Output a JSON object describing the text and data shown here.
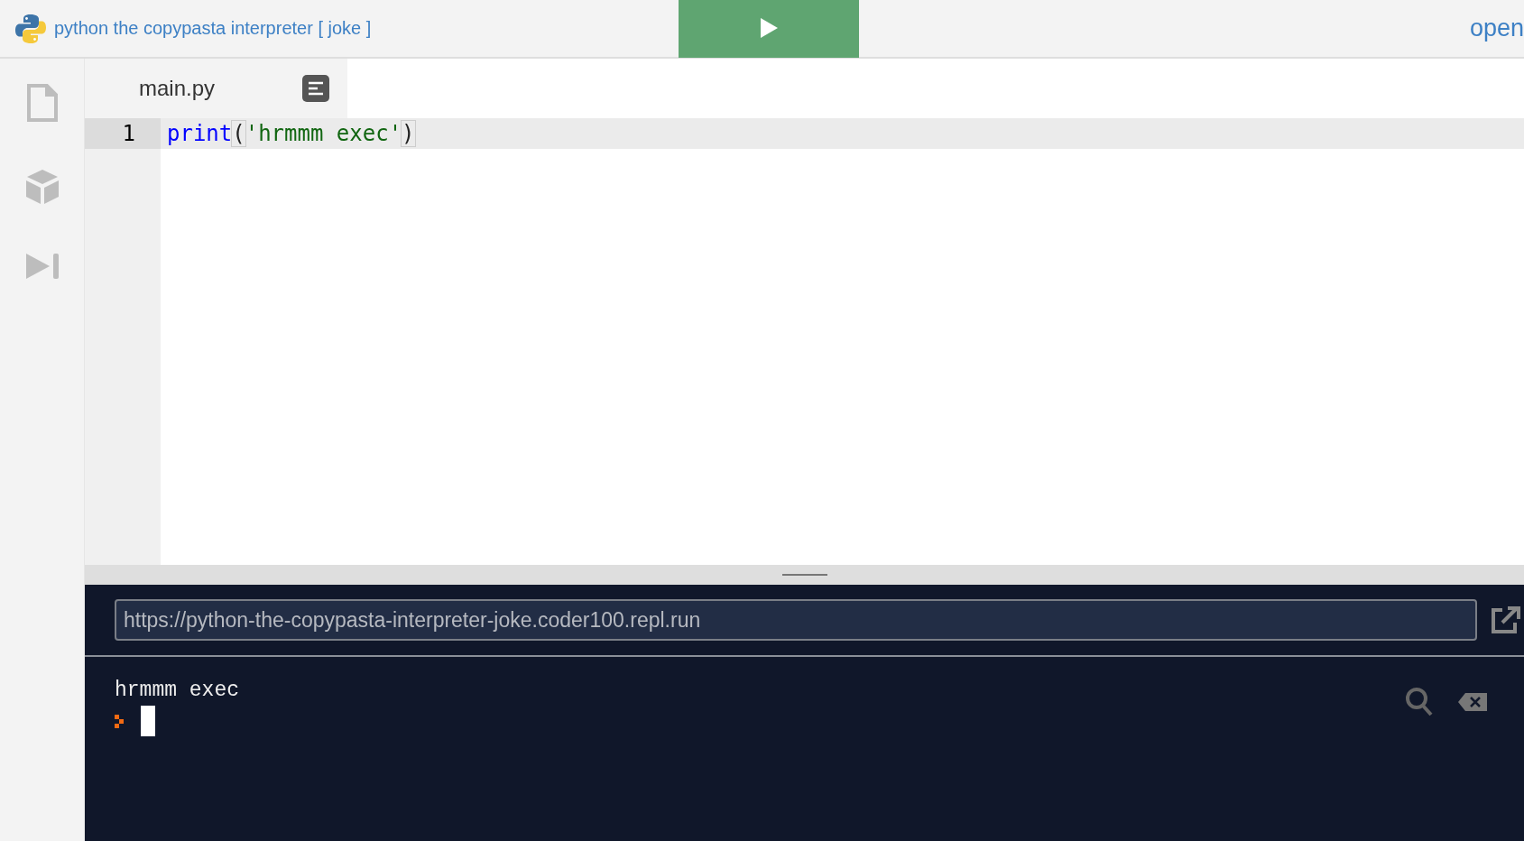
{
  "header": {
    "title": "python the copypasta interpreter [ joke ]",
    "open_link": "open"
  },
  "sidebar": {
    "items": [
      {
        "kind": "files",
        "selected": false
      },
      {
        "kind": "packages",
        "selected": false
      },
      {
        "kind": "debugger",
        "selected": false
      }
    ]
  },
  "editor": {
    "tab": {
      "label": "main.py"
    },
    "lines": [
      {
        "number": "1",
        "tokens": [
          {
            "kind": "builtin",
            "text": "print"
          },
          {
            "kind": "bracket",
            "text": "("
          },
          {
            "kind": "string",
            "text": "'hrmmm exec'"
          },
          {
            "kind": "bracket",
            "text": ")"
          }
        ]
      }
    ]
  },
  "console": {
    "url": "https://python-the-copypasta-interpreter-joke.coder100.repl.run",
    "output": [
      "hrmmm exec"
    ]
  }
}
